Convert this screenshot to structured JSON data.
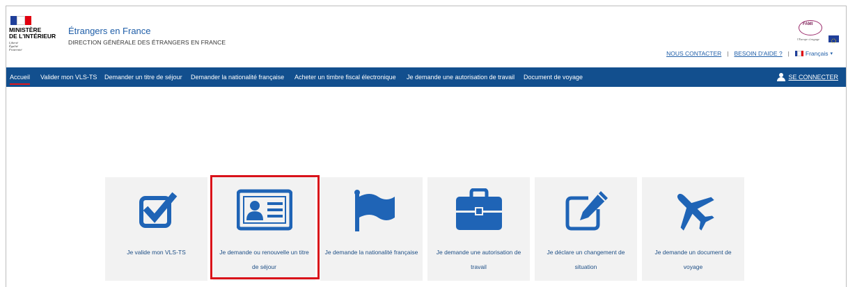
{
  "header": {
    "logo": {
      "lines": [
        "MINISTÈRE",
        "DE L'INTÉRIEUR"
      ],
      "motto": [
        "Liberté",
        "Égalité",
        "Fraternité"
      ]
    },
    "title": "Étrangers en France",
    "subtitle": "DIRECTION GÉNÉRALE DES ÉTRANGERS EN FRANCE",
    "partner_logo": {
      "name": "FAMI",
      "tagline": "l'Europe s'engage",
      "icon": "eu-flag-icon"
    },
    "links": {
      "contact": "NOUS CONTACTER",
      "help": "BESOIN D'AIDE ?",
      "language": "Français"
    }
  },
  "nav": {
    "items": [
      {
        "label": "Accueil",
        "active": true
      },
      {
        "label": "Valider mon VLS-TS"
      },
      {
        "label": "Demander un titre de séjour"
      },
      {
        "label": "Demander la nationalité française"
      },
      {
        "label": "Acheter un timbre fiscal électronique"
      },
      {
        "label": "Je demande une autorisation de travail"
      },
      {
        "label": "Document de voyage"
      }
    ],
    "login": {
      "label": "SE CONNECTER",
      "icon": "user-icon"
    }
  },
  "tiles": [
    {
      "label": "Je valide mon VLS-TS",
      "icon": "checkbox-icon"
    },
    {
      "label": "Je demande ou renouvelle un titre de séjour",
      "icon": "id-card-icon",
      "highlighted": true
    },
    {
      "label": "Je demande la nationalité française",
      "icon": "flag-icon"
    },
    {
      "label": "Je demande une autorisation de travail",
      "icon": "briefcase-icon"
    },
    {
      "label": "Je déclare un changement de situation",
      "icon": "edit-icon"
    },
    {
      "label": "Je demande un document de voyage",
      "icon": "plane-icon"
    }
  ],
  "colors": {
    "brand_blue": "#124f8e",
    "icon_blue": "#1f64b6",
    "link_blue": "#1f5ea8",
    "highlight_red": "#d9121a",
    "tile_bg": "#f2f2f2"
  }
}
